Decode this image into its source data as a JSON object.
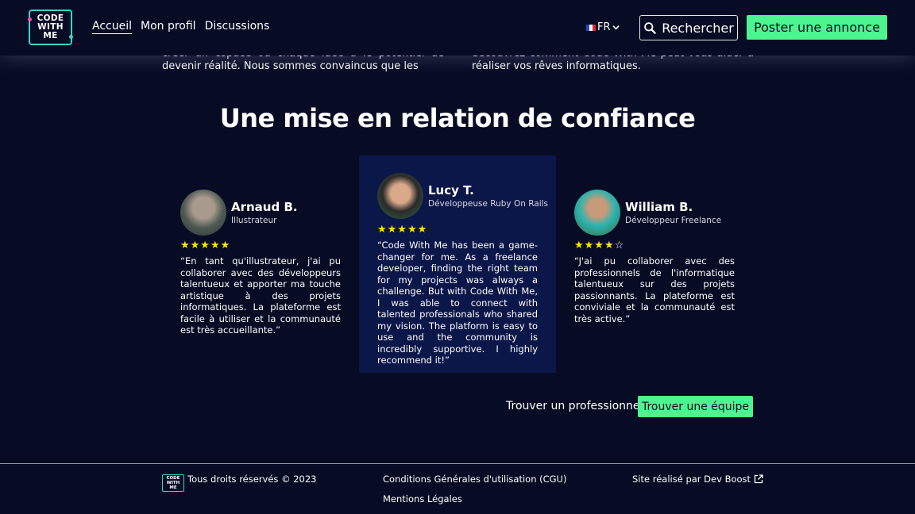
{
  "header": {
    "logo": {
      "line1": "CODE",
      "line2": "WITH",
      "line3": "ME"
    },
    "nav": [
      {
        "label": "Accueil"
      },
      {
        "label": "Mon profil"
      },
      {
        "label": "Discussions"
      }
    ],
    "language": "FR",
    "search_label": "Rechercher",
    "post_label": "Poster une annonce"
  },
  "intro": {
    "left": "créer un espace où chaque idée a le potentiel de devenir réalité. Nous sommes convaincus que les",
    "right": "découvrez comment Code With Me peut vous aider à réaliser vos rêves informatiques."
  },
  "section_title": "Une mise en relation de confiance",
  "testimonials": [
    {
      "name": "Arnaud B.",
      "role": "Illustrateur",
      "rating": 5,
      "stars": "★★★★★",
      "quote": "“En tant qu'illustrateur, j'ai pu collaborer avec des développeurs talentueux et apporter ma touche artistique à des projets informatiques. La plateforme est facile à utiliser et la communauté est très accueillante.”"
    },
    {
      "name": "Lucy T.",
      "role": "Développeuse Ruby On Rails",
      "rating": 5,
      "stars": "★★★★★",
      "quote": "“Code With Me has been a game-changer for me. As a freelance developer, finding the right team for my projects was always a challenge. But with Code With Me, I was able to connect with talented professionals who shared my vision. The platform is easy to use and the community is incredibly supportive. I highly recommend it!”"
    },
    {
      "name": "William B.",
      "role": "Développeur Freelance",
      "rating": 4,
      "stars": "★★★★",
      "stars_empty": "☆",
      "quote": "“J'ai pu collaborer avec des professionnels de l'informatique talentueux sur des projets passionnants. La plateforme est conviviale et la communauté est très active.”"
    }
  ],
  "cta": {
    "find_pro": "Trouver un professionnel",
    "find_team": "Trouver une équipe"
  },
  "footer": {
    "copyright": "Tous droits réservés © 2023",
    "cgu": "Conditions Générales d'utilisation (CGU)",
    "legal": "Mentions Légales",
    "credit": "Site réalisé par Dev Boost"
  },
  "colors": {
    "background": "#070b24",
    "accent_green": "#4cf58f",
    "card_highlight": "#0b1649",
    "star": "#ffe600",
    "logo_border": "#3ad4c8"
  }
}
